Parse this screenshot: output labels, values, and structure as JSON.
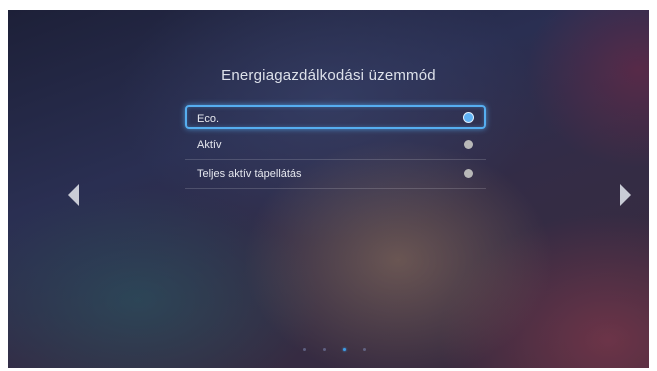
{
  "title": "Energiagazdálkodási üzemmód",
  "options": [
    {
      "label": "Eco.",
      "selected": true
    },
    {
      "label": "Aktív",
      "selected": false
    },
    {
      "label": "Teljes aktív tápellátás",
      "selected": false
    }
  ],
  "navigation": {
    "left_icon": "triangle-left-icon",
    "right_icon": "triangle-right-icon"
  },
  "pagination": {
    "page_count": 4,
    "current_page": 3
  },
  "colors": {
    "selection_accent": "#56aef0",
    "radio_selected": "#5fb2f5",
    "radio_unselected": "#b8b8b8",
    "text": "#e6e8ef"
  }
}
